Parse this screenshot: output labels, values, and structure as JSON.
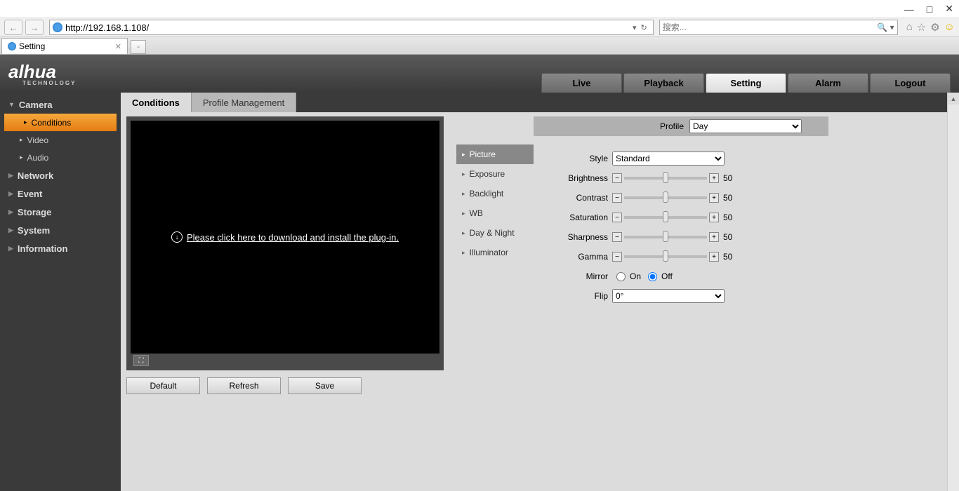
{
  "browser": {
    "url": "http://192.168.1.108/",
    "search_placeholder": "搜索...",
    "tab_title": "Setting"
  },
  "logo": {
    "main": "alhua",
    "sub": "TECHNOLOGY"
  },
  "topnav": [
    "Live",
    "Playback",
    "Setting",
    "Alarm",
    "Logout"
  ],
  "topnav_active": 2,
  "sidebar": [
    {
      "label": "Camera",
      "expanded": true,
      "children": [
        {
          "label": "Conditions",
          "active": true
        },
        {
          "label": "Video"
        },
        {
          "label": "Audio"
        }
      ]
    },
    {
      "label": "Network"
    },
    {
      "label": "Event"
    },
    {
      "label": "Storage"
    },
    {
      "label": "System"
    },
    {
      "label": "Information"
    }
  ],
  "content_tabs": [
    "Conditions",
    "Profile Management"
  ],
  "content_tab_active": 0,
  "preview_msg": "Please click here to download and install the plug-in.",
  "action_buttons": [
    "Default",
    "Refresh",
    "Save"
  ],
  "profile": {
    "label": "Profile",
    "value": "Day"
  },
  "submenu": [
    "Picture",
    "Exposure",
    "Backlight",
    "WB",
    "Day & Night",
    "Illuminator"
  ],
  "submenu_active": 0,
  "params": {
    "style": {
      "label": "Style",
      "value": "Standard"
    },
    "sliders": [
      {
        "label": "Brightness",
        "value": 50
      },
      {
        "label": "Contrast",
        "value": 50
      },
      {
        "label": "Saturation",
        "value": 50
      },
      {
        "label": "Sharpness",
        "value": 50
      },
      {
        "label": "Gamma",
        "value": 50
      }
    ],
    "mirror": {
      "label": "Mirror",
      "value": "Off",
      "options": [
        "On",
        "Off"
      ]
    },
    "flip": {
      "label": "Flip",
      "value": "0°"
    }
  }
}
